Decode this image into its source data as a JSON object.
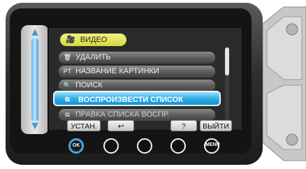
{
  "menu": {
    "title": "ВИДЕО",
    "title_icon": "video-camera-icon",
    "items": [
      {
        "label": "УДАЛИТЬ",
        "icon": "trash-icon",
        "glyph": "🗑"
      },
      {
        "label": "НАЗВАНИЕ КАРТИНКИ",
        "icon": "picture-title-icon",
        "glyph": "PT"
      },
      {
        "label": "ПОИСК",
        "icon": "magnifier-icon",
        "glyph": "🔍"
      },
      {
        "label": "ВОСПРОИЗВЕСТИ СПИСОК",
        "icon": "playlist-icon",
        "glyph": "⧉"
      },
      {
        "label": "ПРАВКА СПИСКА ВОСПР.",
        "icon": "edit-playlist-icon",
        "glyph": "⧉"
      }
    ],
    "selected_index": 3
  },
  "softkeys": {
    "set": "УСТАН.",
    "back_icon": "return-arrow-icon",
    "back_glyph": "↩",
    "help": "?",
    "exit": "ВЫЙТИ"
  },
  "hardware": {
    "ok_label": "OK",
    "menu_label": "MENU"
  },
  "colors": {
    "highlight": "#33aee6",
    "title_bg": "#d7d93a"
  }
}
